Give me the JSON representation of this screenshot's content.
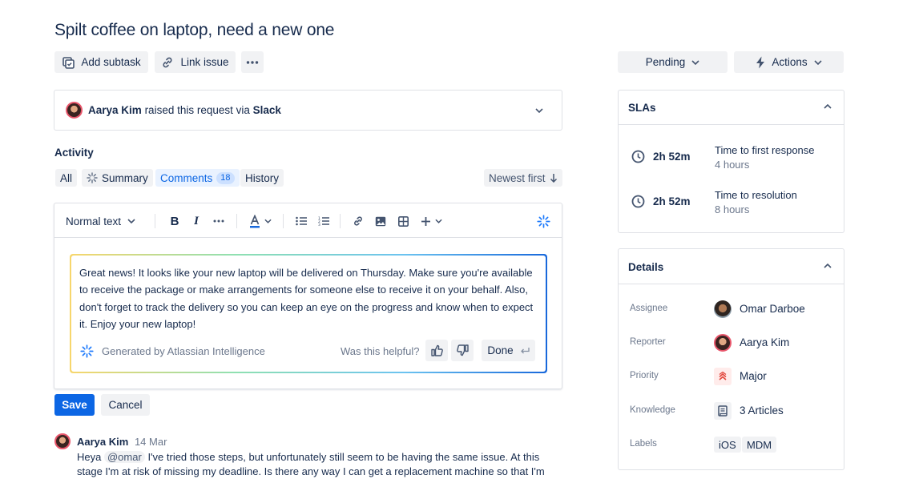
{
  "issue": {
    "title": "Spilt coffee on laptop, need a new one"
  },
  "toolbar": {
    "add_subtask": "Add subtask",
    "link_issue": "Link issue"
  },
  "status": {
    "label": "Pending",
    "actions_label": "Actions"
  },
  "request": {
    "reporter": "Aarya Kim",
    "text": "raised this request via",
    "channel": "Slack"
  },
  "activity": {
    "heading": "Activity",
    "filters": [
      "All",
      "Summary",
      "Comments",
      "History"
    ],
    "comments_count": "18",
    "sort": "Newest first"
  },
  "editor": {
    "text_style": "Normal text",
    "body": "Great news! It looks like your new laptop will be delivered on Thursday. Make sure you're available to receive the package or make arrangements for someone else to receive it on your behalf. Also, don't forget to track the delivery so you can keep an eye on the progress and know when to expect it. Enjoy your new laptop!",
    "generated_by": "Generated by Atlassian Intelligence",
    "helpful_prompt": "Was this helpful?",
    "done_label": "Done"
  },
  "form": {
    "save": "Save",
    "cancel": "Cancel"
  },
  "comment": {
    "author": "Aarya Kim",
    "date": "14 Mar",
    "prefix": "Heya",
    "mention": "@omar",
    "line1": "I've tried those steps, but unfortunately still seem to be having the same issue. At this",
    "line2": "stage I'm at risk of missing my deadline. Is there any way I can get a replacement machine so that I'm"
  },
  "slas": {
    "heading": "SLAs",
    "items": [
      {
        "time": "2h 52m",
        "label": "Time to first response",
        "goal": "4 hours"
      },
      {
        "time": "2h 52m",
        "label": "Time to resolution",
        "goal": "8 hours"
      }
    ]
  },
  "details": {
    "heading": "Details",
    "assignee_label": "Assignee",
    "assignee": "Omar Darboe",
    "reporter_label": "Reporter",
    "reporter": "Aarya Kim",
    "priority_label": "Priority",
    "priority": "Major",
    "knowledge_label": "Knowledge",
    "knowledge": "3 Articles",
    "labels_label": "Labels",
    "labels": [
      "iOS",
      "MDM"
    ]
  },
  "colors": {
    "brand": "#0c66e4",
    "selected_bg": "#e9f2ff",
    "priority": "#e2483d"
  }
}
